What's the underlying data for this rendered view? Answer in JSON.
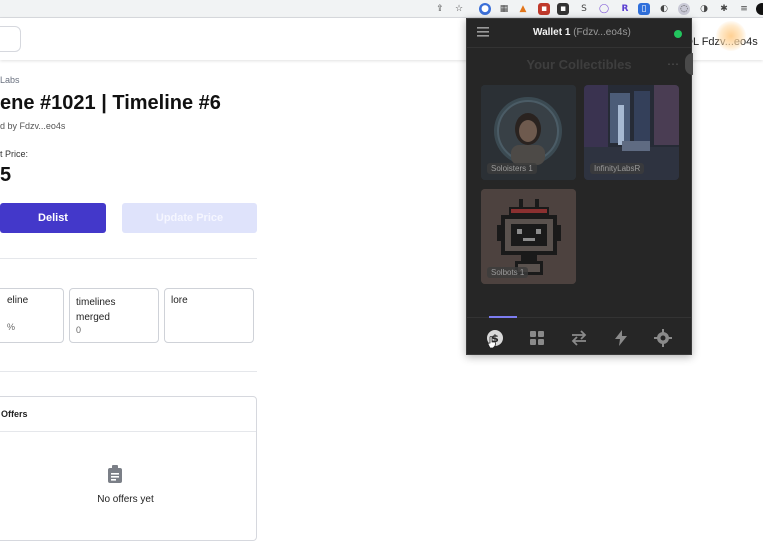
{
  "site": {
    "breadcrumb": "Labs",
    "title": "ene #1021 | Timeline #6",
    "owned_by": "d by Fdzv...eo4s",
    "price_label": "t Price:",
    "price_value": "5",
    "delist_label": "Delist",
    "update_price_label": "Update Price",
    "wallet_button": "DL  Fdzv...eo4s",
    "stats": [
      {
        "label": "eline",
        "value": "%"
      },
      {
        "label": "timelines merged",
        "value": "0"
      },
      {
        "label": "lore",
        "value": ""
      }
    ],
    "offers_title": "Offers",
    "no_offers": "No offers yet"
  },
  "wallet": {
    "name": "Wallet 1",
    "address": "(Fdzv...eo4s)",
    "status_color": "#22c55e",
    "collectibles_title": "Your Collectibles",
    "collectibles": [
      {
        "label": "Soloisters",
        "count": "1",
        "icon": "avatar-image"
      },
      {
        "label": "InfinityLabsR",
        "count": "",
        "icon": "room-image"
      },
      {
        "label": "Solbots",
        "count": "1",
        "icon": "robot-image"
      }
    ],
    "nav": [
      "dollar-icon",
      "grid-icon",
      "swap-icon",
      "bolt-icon",
      "gear-icon"
    ]
  },
  "colors": {
    "primary": "#4338ca",
    "primary_disabled": "#dfe3fb",
    "wallet_bg": "#262626",
    "active_tab": "#7c7cf0"
  }
}
